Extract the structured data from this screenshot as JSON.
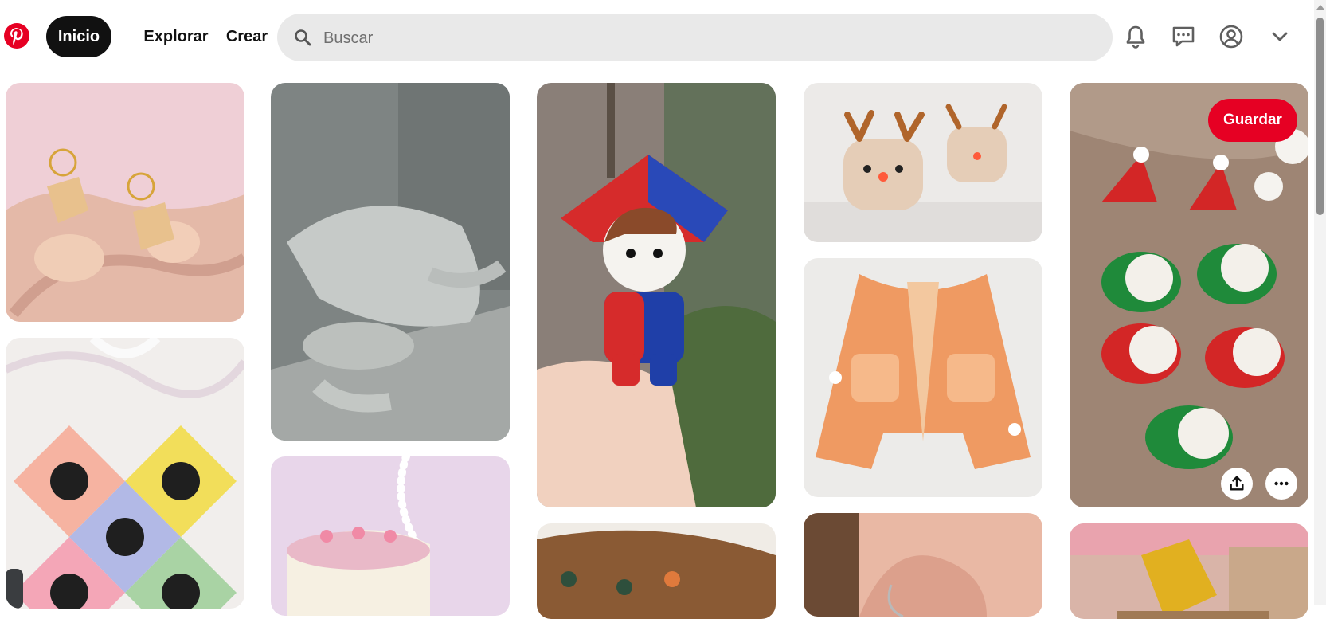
{
  "header": {
    "logo": "pinterest-logo",
    "nav": {
      "home": "Inicio",
      "explore": "Explorar",
      "create": "Crear"
    },
    "search": {
      "placeholder": "Buscar",
      "value": ""
    },
    "icons": [
      "bell-icon",
      "messages-icon",
      "profile-icon",
      "chevron-down-icon"
    ]
  },
  "pin_actions": {
    "save_label": "Guardar",
    "share_icon": "share-icon",
    "more_icon": "more-options-icon"
  },
  "pins": [
    {
      "column": 1,
      "subject": "earrings-photo"
    },
    {
      "column": 1,
      "subject": "crochet-bag-photo"
    },
    {
      "column": 2,
      "subject": "marble-sculpture-photo"
    },
    {
      "column": 2,
      "subject": "pink-cake-photo"
    },
    {
      "column": 3,
      "subject": "crochet-doll-photo"
    },
    {
      "column": 3,
      "subject": "clay-earrings-photo"
    },
    {
      "column": 4,
      "subject": "crochet-reindeer-photo"
    },
    {
      "column": 4,
      "subject": "orange-cardigan-photo"
    },
    {
      "column": 4,
      "subject": "ear-earring-photo"
    },
    {
      "column": 5,
      "subject": "christmas-hairclips-photo",
      "hovered": true
    },
    {
      "column": 5,
      "subject": "crochet-yellow-photo"
    }
  ],
  "colors": {
    "brand": "#e60023",
    "nav_active": "#111111",
    "search_bg": "#e9e9e9"
  }
}
